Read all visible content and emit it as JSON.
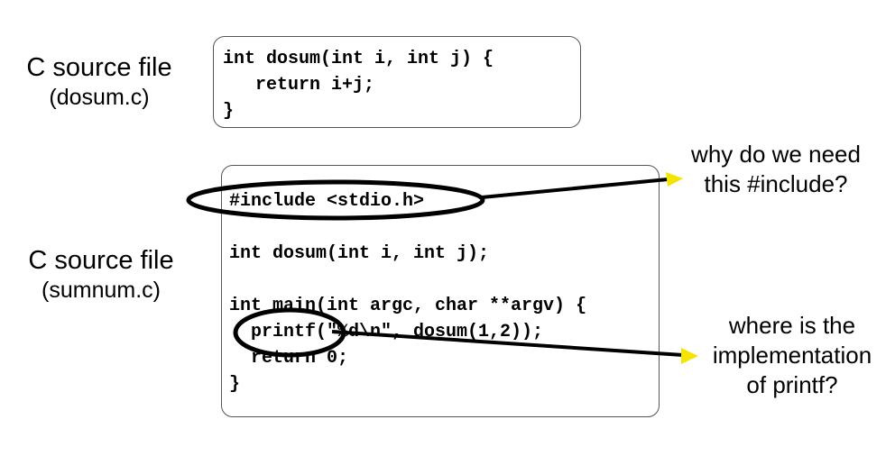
{
  "file1": {
    "title": "C source file",
    "filename": "(dosum.c)",
    "code": [
      "int dosum(int i, int j) {",
      "   return i+j;",
      "}"
    ]
  },
  "file2": {
    "title": "C source file",
    "filename": "(sumnum.c)",
    "code": [
      "#include <stdio.h>",
      "",
      "int dosum(int i, int j);",
      "",
      "int main(int argc, char **argv) {",
      "  printf(\"%d\\n\", dosum(1,2));",
      "  return 0;",
      "}"
    ]
  },
  "callouts": {
    "include_question": [
      "why do we need",
      "this #include?"
    ],
    "printf_question": [
      "where is the",
      "implementation",
      "of printf?"
    ]
  },
  "colors": {
    "arrowhead": "#f5e400",
    "line": "#000000",
    "box_border": "#555555"
  }
}
